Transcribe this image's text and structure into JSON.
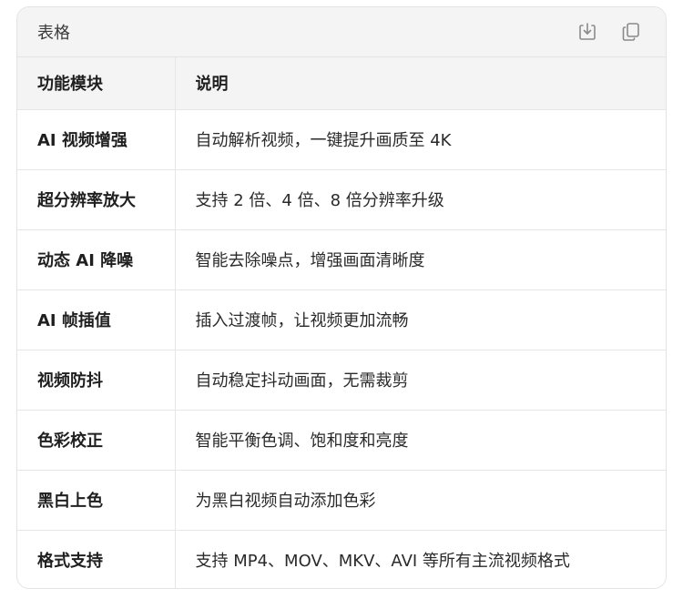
{
  "card": {
    "title": "表格",
    "icons": {
      "download": "download-icon",
      "copy": "copy-icon"
    }
  },
  "table": {
    "headers": [
      "功能模块",
      "说明"
    ],
    "rows": [
      {
        "module": "AI 视频增强",
        "desc": "自动解析视频，一键提升画质至 4K"
      },
      {
        "module": "超分辨率放大",
        "desc": "支持 2 倍、4 倍、8 倍分辨率升级"
      },
      {
        "module": "动态 AI 降噪",
        "desc": "智能去除噪点，增强画面清晰度"
      },
      {
        "module": "AI 帧插值",
        "desc": "插入过渡帧，让视频更加流畅"
      },
      {
        "module": "视频防抖",
        "desc": "自动稳定抖动画面，无需裁剪"
      },
      {
        "module": "色彩校正",
        "desc": "智能平衡色调、饱和度和亮度"
      },
      {
        "module": "黑白上色",
        "desc": "为黑白视频自动添加色彩"
      },
      {
        "module": "格式支持",
        "desc": "支持 MP4、MOV、MKV、AVI 等所有主流视频格式"
      }
    ]
  },
  "colors": {
    "header_bg": "#f4f4f4",
    "border": "#e3e3e3",
    "text": "#1f1f1f",
    "icon": "#8a8a8a"
  }
}
